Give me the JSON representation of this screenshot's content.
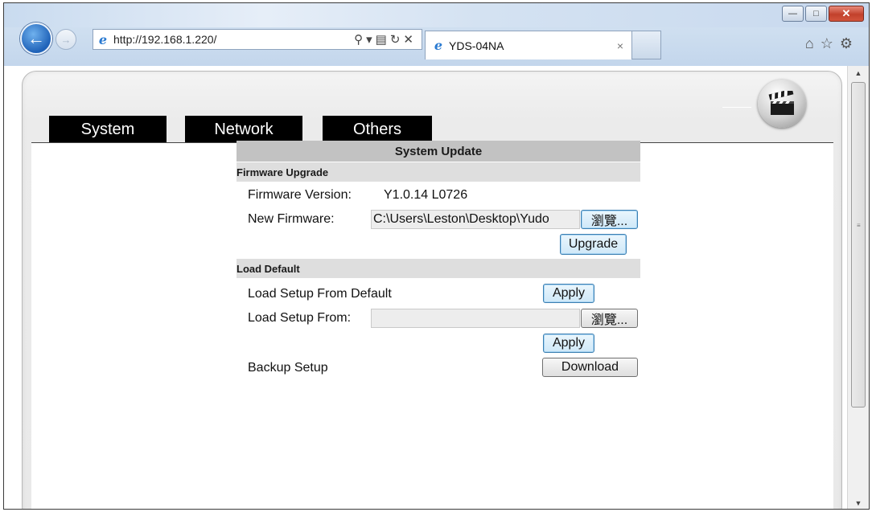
{
  "browser": {
    "url": "http://192.168.1.220/",
    "tab_title": "YDS-04NA",
    "tab_close": "×"
  },
  "nav_tabs": [
    "System",
    "Network",
    "Others"
  ],
  "panel": {
    "title": "System Update",
    "firmware": {
      "section": "Firmware Upgrade",
      "version_label": "Firmware Version:",
      "version_value": "Y1.0.14 L0726",
      "new_label": "New Firmware:",
      "new_value": "C:\\Users\\Leston\\Desktop\\Yudo",
      "browse_label": "瀏覽...",
      "upgrade_label": "Upgrade"
    },
    "defaults": {
      "section": "Load Default",
      "from_default_label": "Load Setup From Default",
      "apply_label": "Apply",
      "from_label": "Load Setup From:",
      "from_value": "",
      "browse_label": "瀏覽...",
      "apply2_label": "Apply",
      "backup_label": "Backup Setup",
      "download_label": "Download"
    }
  }
}
